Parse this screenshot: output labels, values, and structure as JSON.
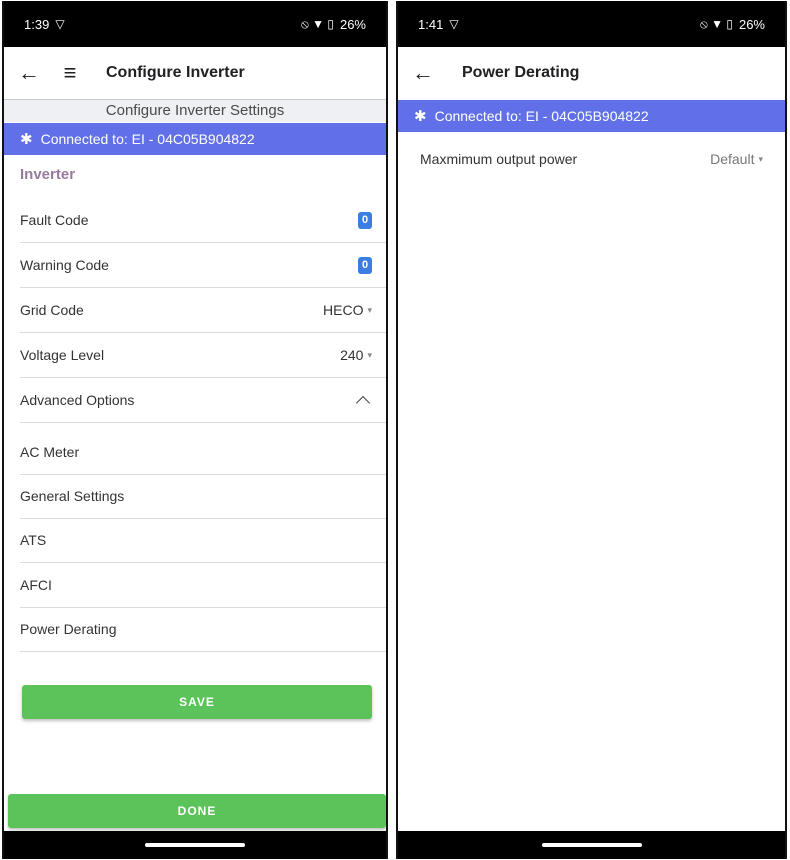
{
  "left": {
    "status": {
      "time": "1:39",
      "left_icon": "▽",
      "right_icons": "⦸ ▼ ▯",
      "battery": "26%"
    },
    "appbar": {
      "back_icon": "←",
      "menu_icon": "≡",
      "title": "Configure Inverter"
    },
    "subheader": "Configure Inverter Settings",
    "connection": {
      "icon": "✱",
      "text": "Connected to: EI - 04C05B904822"
    },
    "section_title": "Inverter",
    "rows": {
      "fault_code": {
        "label": "Fault Code",
        "value": "0"
      },
      "warning_code": {
        "label": "Warning Code",
        "value": "0"
      },
      "grid_code": {
        "label": "Grid Code",
        "value": "HECO",
        "caret": "▾"
      },
      "voltage_level": {
        "label": "Voltage Level",
        "value": "240",
        "caret": "▾"
      },
      "advanced_options": {
        "label": "Advanced Options"
      },
      "ac_meter": {
        "label": "AC Meter"
      },
      "general_settings": {
        "label": "General Settings"
      },
      "ats": {
        "label": "ATS"
      },
      "afci": {
        "label": "AFCI"
      },
      "power_derating": {
        "label": "Power Derating"
      }
    },
    "save_label": "SAVE",
    "done_label": "DONE"
  },
  "right": {
    "status": {
      "time": "1:41",
      "left_icon": "▽",
      "right_icons": "⦸ ▼ ▯",
      "battery": "26%"
    },
    "appbar": {
      "back_icon": "←",
      "title": "Power Derating"
    },
    "connection": {
      "icon": "✱",
      "text": "Connected to: EI - 04C05B904822"
    },
    "rows": {
      "max_output_power": {
        "label": "Maxmimum output power",
        "value": "Default",
        "caret": "▾"
      }
    }
  },
  "colors": {
    "connection_bar": "#6170e8",
    "section_title": "#9b7aa0",
    "badge": "#3b7de0",
    "primary_button": "#5cc35a"
  }
}
